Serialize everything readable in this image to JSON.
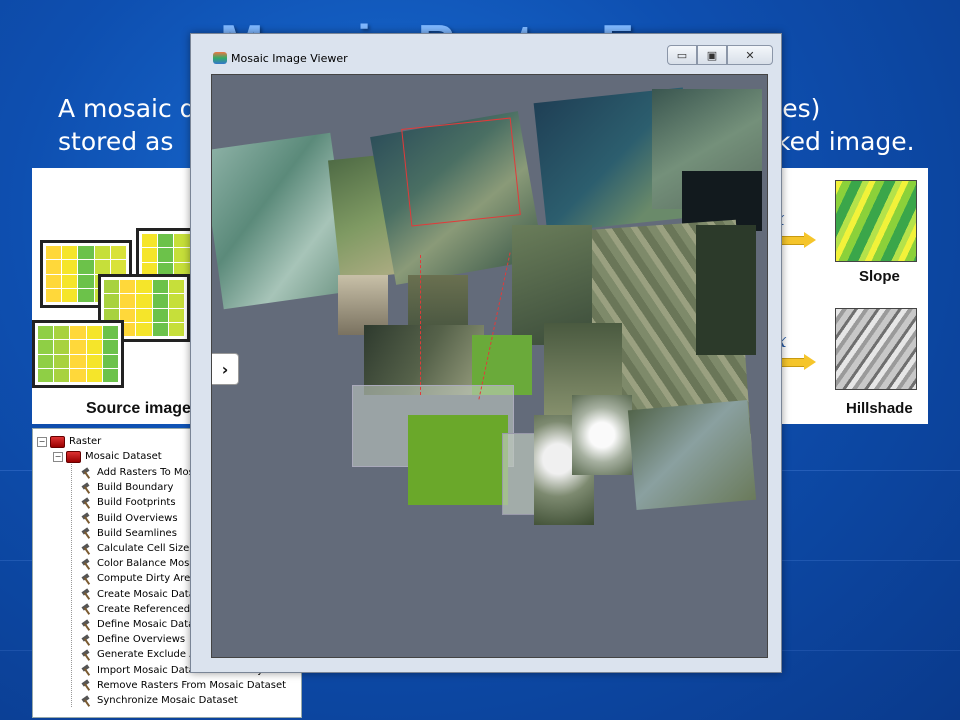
{
  "slide": {
    "title": "Mosaic Raster Fe",
    "line1_left": "A mosaic d",
    "line1_right": "ages)",
    "line2_left": "stored as",
    "line2_right": "ked image."
  },
  "left_panel": {
    "label": "Source images"
  },
  "right_panel": {
    "fx_top": "fx",
    "fx_bottom": "fx",
    "slope_label": "Slope",
    "hillshade_label": "Hillshade"
  },
  "toolbox": {
    "root": "Raster",
    "group": "Mosaic Dataset",
    "tools": [
      "Add Rasters To Mos",
      "Build Boundary",
      "Build Footprints",
      "Build Overviews",
      "Build Seamlines",
      "Calculate Cell Size R",
      "Color Balance Mosa",
      "Compute Dirty Area",
      "Create Mosaic Datas",
      "Create Referenced M",
      "Define Mosaic Datas",
      "Define Overviews",
      "Generate Exclude Ar",
      "Import Mosaic Dataset Geometry",
      "Remove Rasters From Mosaic Dataset",
      "Synchronize Mosaic Dataset"
    ]
  },
  "viewer": {
    "title": "Mosaic Image Viewer",
    "minimize": "▭",
    "restore": "▣",
    "close": "✕",
    "nav_toggle": "›"
  }
}
